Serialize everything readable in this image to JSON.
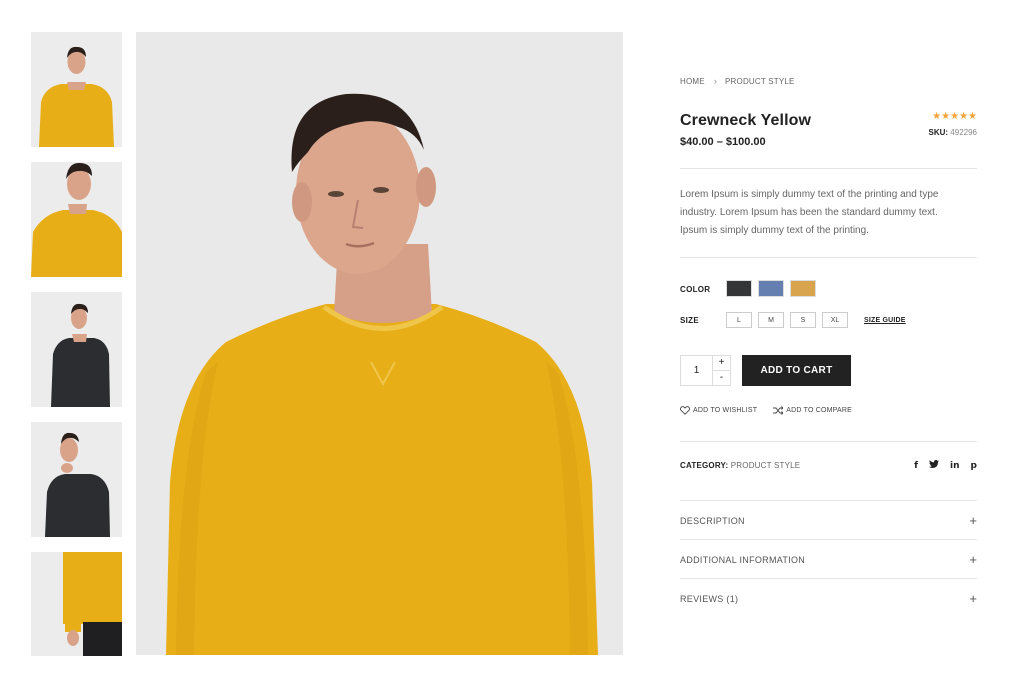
{
  "breadcrumb": {
    "home": "HOME",
    "separator": "›",
    "current": "PRODUCT STYLE"
  },
  "product": {
    "title": "Crewneck Yellow",
    "price": "$40.00 – $100.00",
    "rating_stars": 5,
    "sku_label": "SKU:",
    "sku_value": "492296",
    "description": "Lorem Ipsum is simply dummy text of the printing and type industry. Lorem Ipsum has been the standard dummy text. Ipsum is simply dummy text of the printing."
  },
  "options": {
    "color_label": "COLOR",
    "colors": [
      "#333537",
      "#6580b0",
      "#d8a44d"
    ],
    "size_label": "SIZE",
    "sizes": [
      "L",
      "M",
      "S",
      "XL"
    ],
    "size_guide": "SIZE GUIDE"
  },
  "cart": {
    "quantity": "1",
    "plus": "+",
    "minus": "-",
    "add_label": "ADD TO CART"
  },
  "links": {
    "wishlist": "ADD TO WISHLIST",
    "compare": "ADD TO COMPARE"
  },
  "category": {
    "label": "CATEGORY:",
    "value": "PRODUCT STYLE"
  },
  "social": {
    "facebook": "f",
    "twitter": "t",
    "linkedin": "in",
    "pinterest": "p"
  },
  "accordion": [
    {
      "label": "DESCRIPTION",
      "icon": "+"
    },
    {
      "label": "ADDITIONAL INFORMATION",
      "icon": "+"
    },
    {
      "label": "REVIEWS (1)",
      "icon": "+"
    }
  ],
  "colors": {
    "sweater_yellow": "#e8ae17",
    "sweater_dark": "#2b2d31",
    "star": "#f6a33a",
    "button": "#222222"
  }
}
